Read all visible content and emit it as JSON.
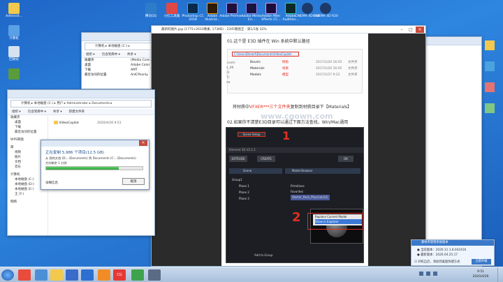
{
  "desktop": {
    "left_icons": [
      "Administ...",
      "计算机",
      "回收站",
      "",
      "WPS网盘"
    ],
    "top_icons": [
      "腾讯QQ",
      "小红工具箱",
      "Photoshop CC 2018",
      "Adobe Illustrat...",
      "Adobe Premie...",
      "Adobe Media En...",
      "Adobe After Effects CC...",
      "Adobe Audition...",
      "CINEMA 4D R19",
      "CINEMA 4D R20"
    ]
  },
  "explorer_back": {
    "address": "计算机 ▸ 本地磁盘 (C:) ▸",
    "toolbar": [
      "组织 ▾",
      "包含到库中 ▾",
      "共享 ▾"
    ],
    "nav": [
      "收藏夹",
      "桌面",
      "下载",
      "最近访问的位置"
    ],
    "list": [
      "(Media Core p",
      "Adobe Color",
      "AMT",
      "AnICPsonly"
    ],
    "extra_list": [
      ".com)",
      "s_4K",
      ")1",
      "7)",
      "rw"
    ]
  },
  "explorer_front": {
    "address": "计算机 ▸ 本地磁盘 (C:) ▸ 用户 ▸ Administrator ▸ Documents ▸",
    "toolbar": [
      "组织 ▾",
      "包含到库中 ▾",
      "共享 ▾",
      "新建文件夹"
    ],
    "nav": [
      "收藏夹",
      "桌面",
      "下载",
      "最近访问的位置",
      "WPS网盘",
      "库",
      "视频",
      "图片",
      "文档",
      "音乐",
      "计算机",
      "本地磁盘 (C:)",
      "本地磁盘 (D:)",
      "本地磁盘 (E:)",
      "王 (F:)",
      "网络"
    ],
    "file": {
      "name": "VideoCopilot",
      "date": "2020/4/26 9:51"
    }
  },
  "copy_dialog": {
    "status": "正在复制 5,986 个项目(12.5 GB)",
    "from_to": "从 我的文档 (D:...\\Documents) 到 Documents (C:...\\Documents)",
    "remaining": "大约剩余 1 分钟",
    "more": "详细信息",
    "cancel": "取消",
    "progress": 0.75
  },
  "viewer": {
    "title": "最新的图片.jpg (1775×2610像素, 173KB) - 2345看图王 - 第1/1张 32%",
    "heading1": "01.这个是 E3D 插件在 Win 系统中默认路径",
    "path": "C:\\Users\\Desert\\Documents\\VideoCopilot",
    "folders": [
      {
        "name": "Bevels",
        "note": "倒角",
        "date": "2017/2/20 16:05",
        "type": "文件夹"
      },
      {
        "name": "Materials",
        "note": "材质",
        "date": "2017/2/20 16:05",
        "type": "文件夹"
      },
      {
        "name": "Models",
        "note": "模型",
        "date": "2017/2/27 9:22",
        "type": "文件夹"
      }
    ],
    "line2_prefix": "将材质中",
    "line2_red": "VFXER***三个文件夹",
    "line2_suffix": "复制到材质目录下【Materials】",
    "watermark": "www.cgown.com",
    "heading2": "02.如果你不清楚E3D目录可以通过下面方法查找，Win/Mac通用",
    "e3d": {
      "scene_setup": "Scene Setup",
      "app_title": "Element 3D V2.2.2",
      "extrude": "EXTRUDE",
      "create": "CREATE",
      "ok": "OK",
      "scene": "Scene",
      "model_browser": "Model Browser",
      "group": "Group1",
      "planes": [
        "Plane 1",
        "Plane 2",
        "Plane 3"
      ],
      "tree": [
        "Primitives",
        "Favorites",
        "Starter_Pack_Physical(32)"
      ],
      "menu": [
        "Replace Current Model",
        "Show in Explorer"
      ],
      "add_group": "Add to Group",
      "marks": [
        "1",
        "2"
      ]
    }
  },
  "notification": {
    "title": "素材库管理系统版本",
    "current": "● 当前版本：2020.11.1.8.042416",
    "latest": "● 最新版本：2020.04.25.17",
    "checkbox": "☑ 开机自启，添加到桌面快捷方式",
    "button": "立即升级"
  },
  "taskbar": {
    "time": "9:51",
    "date": "2020/4/26",
    "app_label": "CG"
  }
}
